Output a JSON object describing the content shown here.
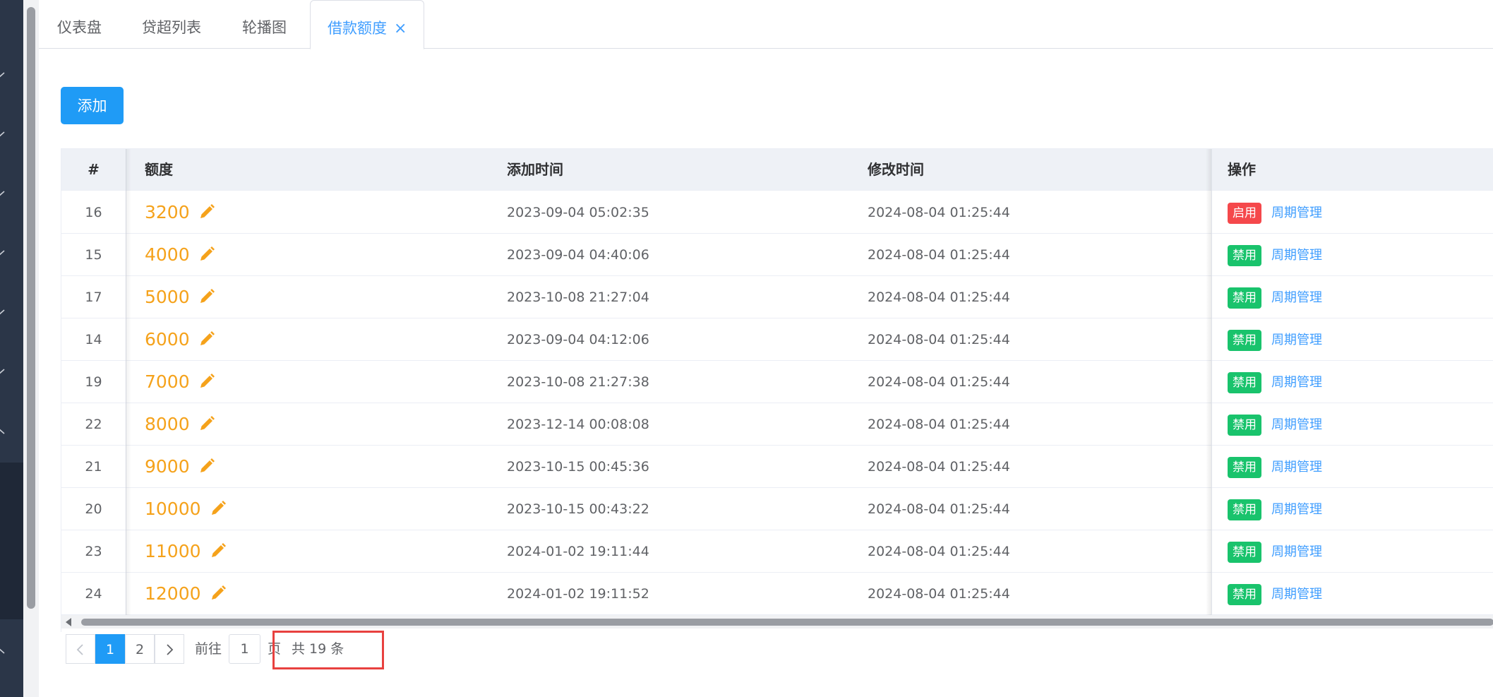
{
  "tabs": [
    {
      "label": "仪表盘"
    },
    {
      "label": "贷超列表"
    },
    {
      "label": "轮播图"
    },
    {
      "label": "借款额度",
      "close": "×"
    }
  ],
  "toolbar": {
    "add_label": "添加"
  },
  "table": {
    "headers": {
      "id": "#",
      "amount": "额度",
      "added": "添加时间",
      "modified": "修改时间",
      "ops": "操作"
    },
    "rows": [
      {
        "id": "16",
        "amount": "3200",
        "added": "2023-09-04 05:02:35",
        "modified": "2024-08-04 01:25:44",
        "status": "启用",
        "status_color": "#f5484b",
        "link": "周期管理"
      },
      {
        "id": "15",
        "amount": "4000",
        "added": "2023-09-04 04:40:06",
        "modified": "2024-08-04 01:25:44",
        "status": "禁用",
        "status_color": "#19c36c",
        "link": "周期管理"
      },
      {
        "id": "17",
        "amount": "5000",
        "added": "2023-10-08 21:27:04",
        "modified": "2024-08-04 01:25:44",
        "status": "禁用",
        "status_color": "#19c36c",
        "link": "周期管理"
      },
      {
        "id": "14",
        "amount": "6000",
        "added": "2023-09-04 04:12:06",
        "modified": "2024-08-04 01:25:44",
        "status": "禁用",
        "status_color": "#19c36c",
        "link": "周期管理"
      },
      {
        "id": "19",
        "amount": "7000",
        "added": "2023-10-08 21:27:38",
        "modified": "2024-08-04 01:25:44",
        "status": "禁用",
        "status_color": "#19c36c",
        "link": "周期管理"
      },
      {
        "id": "22",
        "amount": "8000",
        "added": "2023-12-14 00:08:08",
        "modified": "2024-08-04 01:25:44",
        "status": "禁用",
        "status_color": "#19c36c",
        "link": "周期管理"
      },
      {
        "id": "21",
        "amount": "9000",
        "added": "2023-10-15 00:45:36",
        "modified": "2024-08-04 01:25:44",
        "status": "禁用",
        "status_color": "#19c36c",
        "link": "周期管理"
      },
      {
        "id": "20",
        "amount": "10000",
        "added": "2023-10-15 00:43:22",
        "modified": "2024-08-04 01:25:44",
        "status": "禁用",
        "status_color": "#19c36c",
        "link": "周期管理"
      },
      {
        "id": "23",
        "amount": "11000",
        "added": "2024-01-02 19:11:44",
        "modified": "2024-08-04 01:25:44",
        "status": "禁用",
        "status_color": "#19c36c",
        "link": "周期管理"
      },
      {
        "id": "24",
        "amount": "12000",
        "added": "2024-01-02 19:11:52",
        "modified": "2024-08-04 01:25:44",
        "status": "禁用",
        "status_color": "#19c36c",
        "link": "周期管理"
      }
    ]
  },
  "pagination": {
    "prev_icon": "chevron-left-icon",
    "pages": [
      "1",
      "2"
    ],
    "current": "1",
    "next_icon": "chevron-right-icon",
    "goto_label": "前往",
    "goto_value": "1",
    "page_suffix": "页",
    "total": "共 19 条"
  },
  "colors": {
    "accent": "#1f9bf6",
    "amount": "#f5a21b",
    "enable_badge": "#f5484b",
    "disable_badge": "#19c36c",
    "highlight": "#e8413f",
    "sidebar": "#2b3648"
  }
}
